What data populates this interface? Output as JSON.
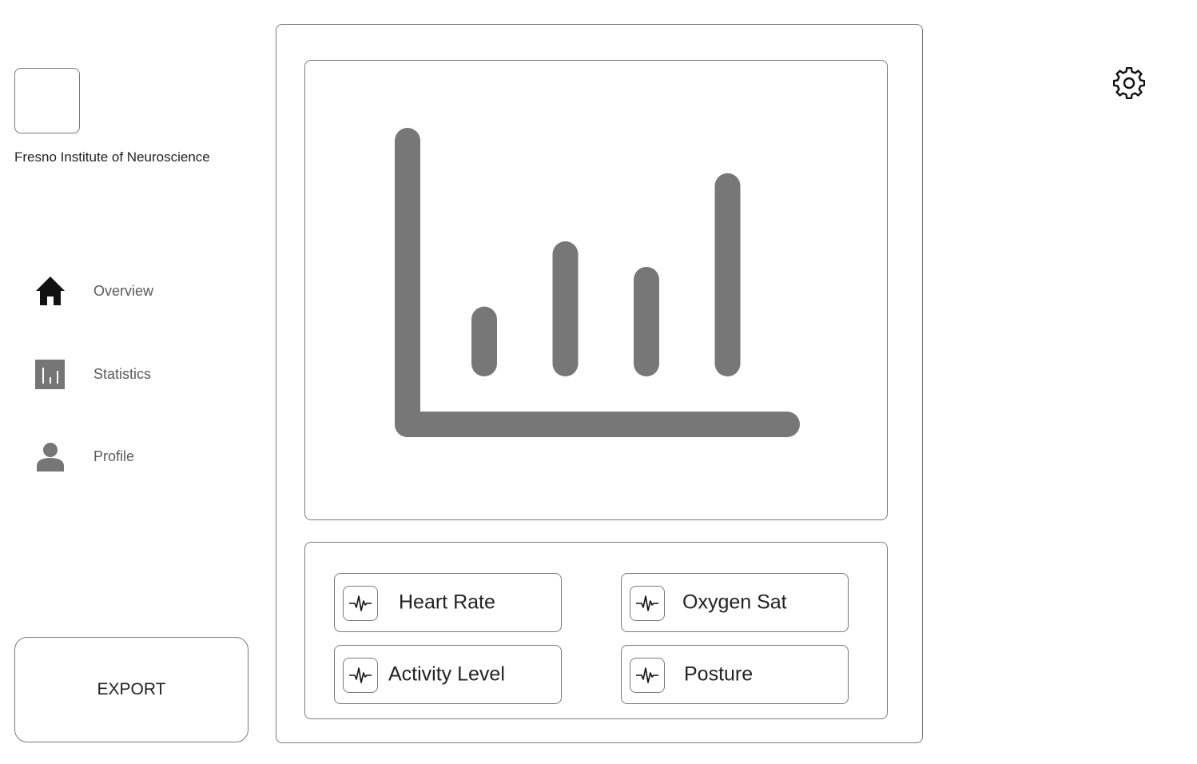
{
  "sidebar": {
    "org_name": "Fresno Institute of Neuroscience",
    "nav": [
      {
        "label": "Overview",
        "icon": "home-icon"
      },
      {
        "label": "Statistics",
        "icon": "bar-chart-icon"
      },
      {
        "label": "Profile",
        "icon": "person-icon"
      }
    ],
    "export_label": "EXPORT"
  },
  "chart_data": {
    "type": "bar",
    "categories": [
      "",
      "",
      "",
      ""
    ],
    "values": [
      37,
      60,
      51,
      84
    ],
    "ylim": [
      0,
      100
    ],
    "grid": false,
    "legend": "none",
    "color": "#777777"
  },
  "metrics": [
    {
      "label": "Heart Rate",
      "icon": "pulse-icon"
    },
    {
      "label": "Oxygen Sat",
      "icon": "pulse-icon"
    },
    {
      "label": "Activity Level",
      "icon": "pulse-icon"
    },
    {
      "label": "Posture",
      "icon": "pulse-icon"
    }
  ],
  "header": {
    "settings_icon": "gear-icon"
  },
  "colors": {
    "border": "#7a7a7a",
    "chart": "#777777",
    "nav_text": "#5a5a5a",
    "text": "#222222"
  }
}
